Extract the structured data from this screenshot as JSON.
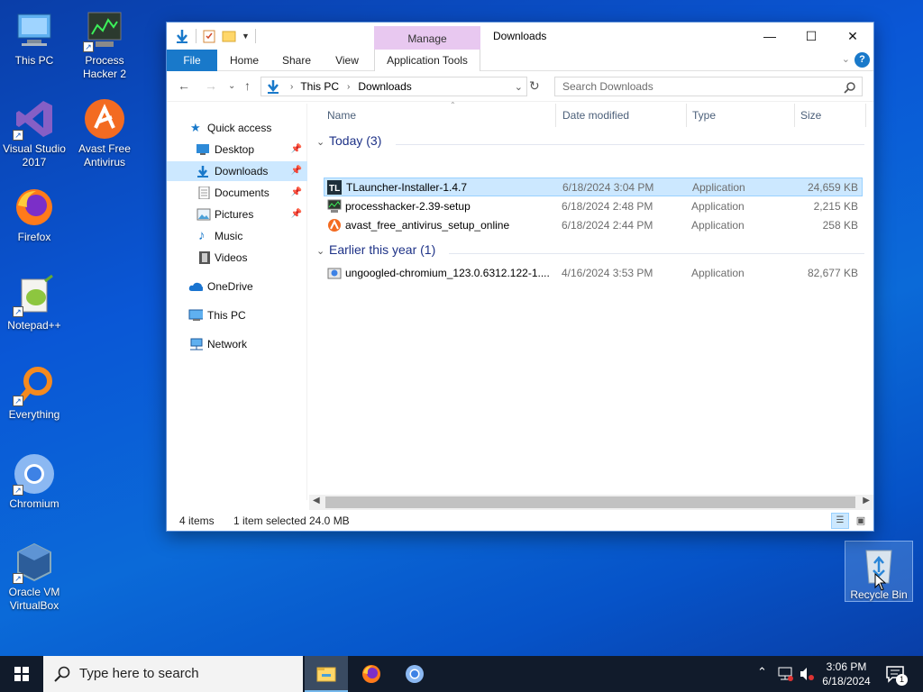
{
  "desktop": {
    "icons": [
      {
        "label": "This PC"
      },
      {
        "label": "Process Hacker 2"
      },
      {
        "label": "Visual Studio 2017"
      },
      {
        "label": "Avast Free Antivirus"
      },
      {
        "label": "Firefox"
      },
      {
        "label": "Notepad++"
      },
      {
        "label": "Everything"
      },
      {
        "label": "Chromium"
      },
      {
        "label": "Oracle VM VirtualBox"
      },
      {
        "label": "Recycle Bin"
      }
    ]
  },
  "window": {
    "title": "Downloads",
    "manage_tab": "Manage",
    "tabs": {
      "file": "File",
      "home": "Home",
      "share": "Share",
      "view": "View",
      "app_tools": "Application Tools"
    },
    "address": {
      "segments": [
        "This PC",
        "Downloads"
      ]
    },
    "search_placeholder": "Search Downloads",
    "sidebar": [
      {
        "label": "Quick access"
      },
      {
        "label": "Desktop"
      },
      {
        "label": "Downloads"
      },
      {
        "label": "Documents"
      },
      {
        "label": "Pictures"
      },
      {
        "label": "Music"
      },
      {
        "label": "Videos"
      },
      {
        "label": "OneDrive"
      },
      {
        "label": "This PC"
      },
      {
        "label": "Network"
      }
    ],
    "columns": {
      "name": "Name",
      "date": "Date modified",
      "type": "Type",
      "size": "Size"
    },
    "groups": [
      {
        "label": "Today (3)",
        "files": [
          {
            "name": "TLauncher-Installer-1.4.7",
            "date": "6/18/2024 3:04 PM",
            "type": "Application",
            "size": "24,659 KB"
          },
          {
            "name": "processhacker-2.39-setup",
            "date": "6/18/2024 2:48 PM",
            "type": "Application",
            "size": "2,215 KB"
          },
          {
            "name": "avast_free_antivirus_setup_online",
            "date": "6/18/2024 2:44 PM",
            "type": "Application",
            "size": "258 KB"
          }
        ]
      },
      {
        "label": "Earlier this year (1)",
        "files": [
          {
            "name": "ungoogled-chromium_123.0.6312.122-1....",
            "date": "4/16/2024 3:53 PM",
            "type": "Application",
            "size": "82,677 KB"
          }
        ]
      }
    ],
    "status": {
      "items": "4 items",
      "selected": "1 item selected",
      "size": "24.0 MB"
    }
  },
  "taskbar": {
    "search_placeholder": "Type here to search",
    "time": "3:06 PM",
    "date": "6/18/2024",
    "notification_count": "1"
  },
  "colors": {
    "accent": "#1979ca",
    "selection": "#cce8ff",
    "manage": "#e8c8f0",
    "taskbar": "#111b2b"
  }
}
